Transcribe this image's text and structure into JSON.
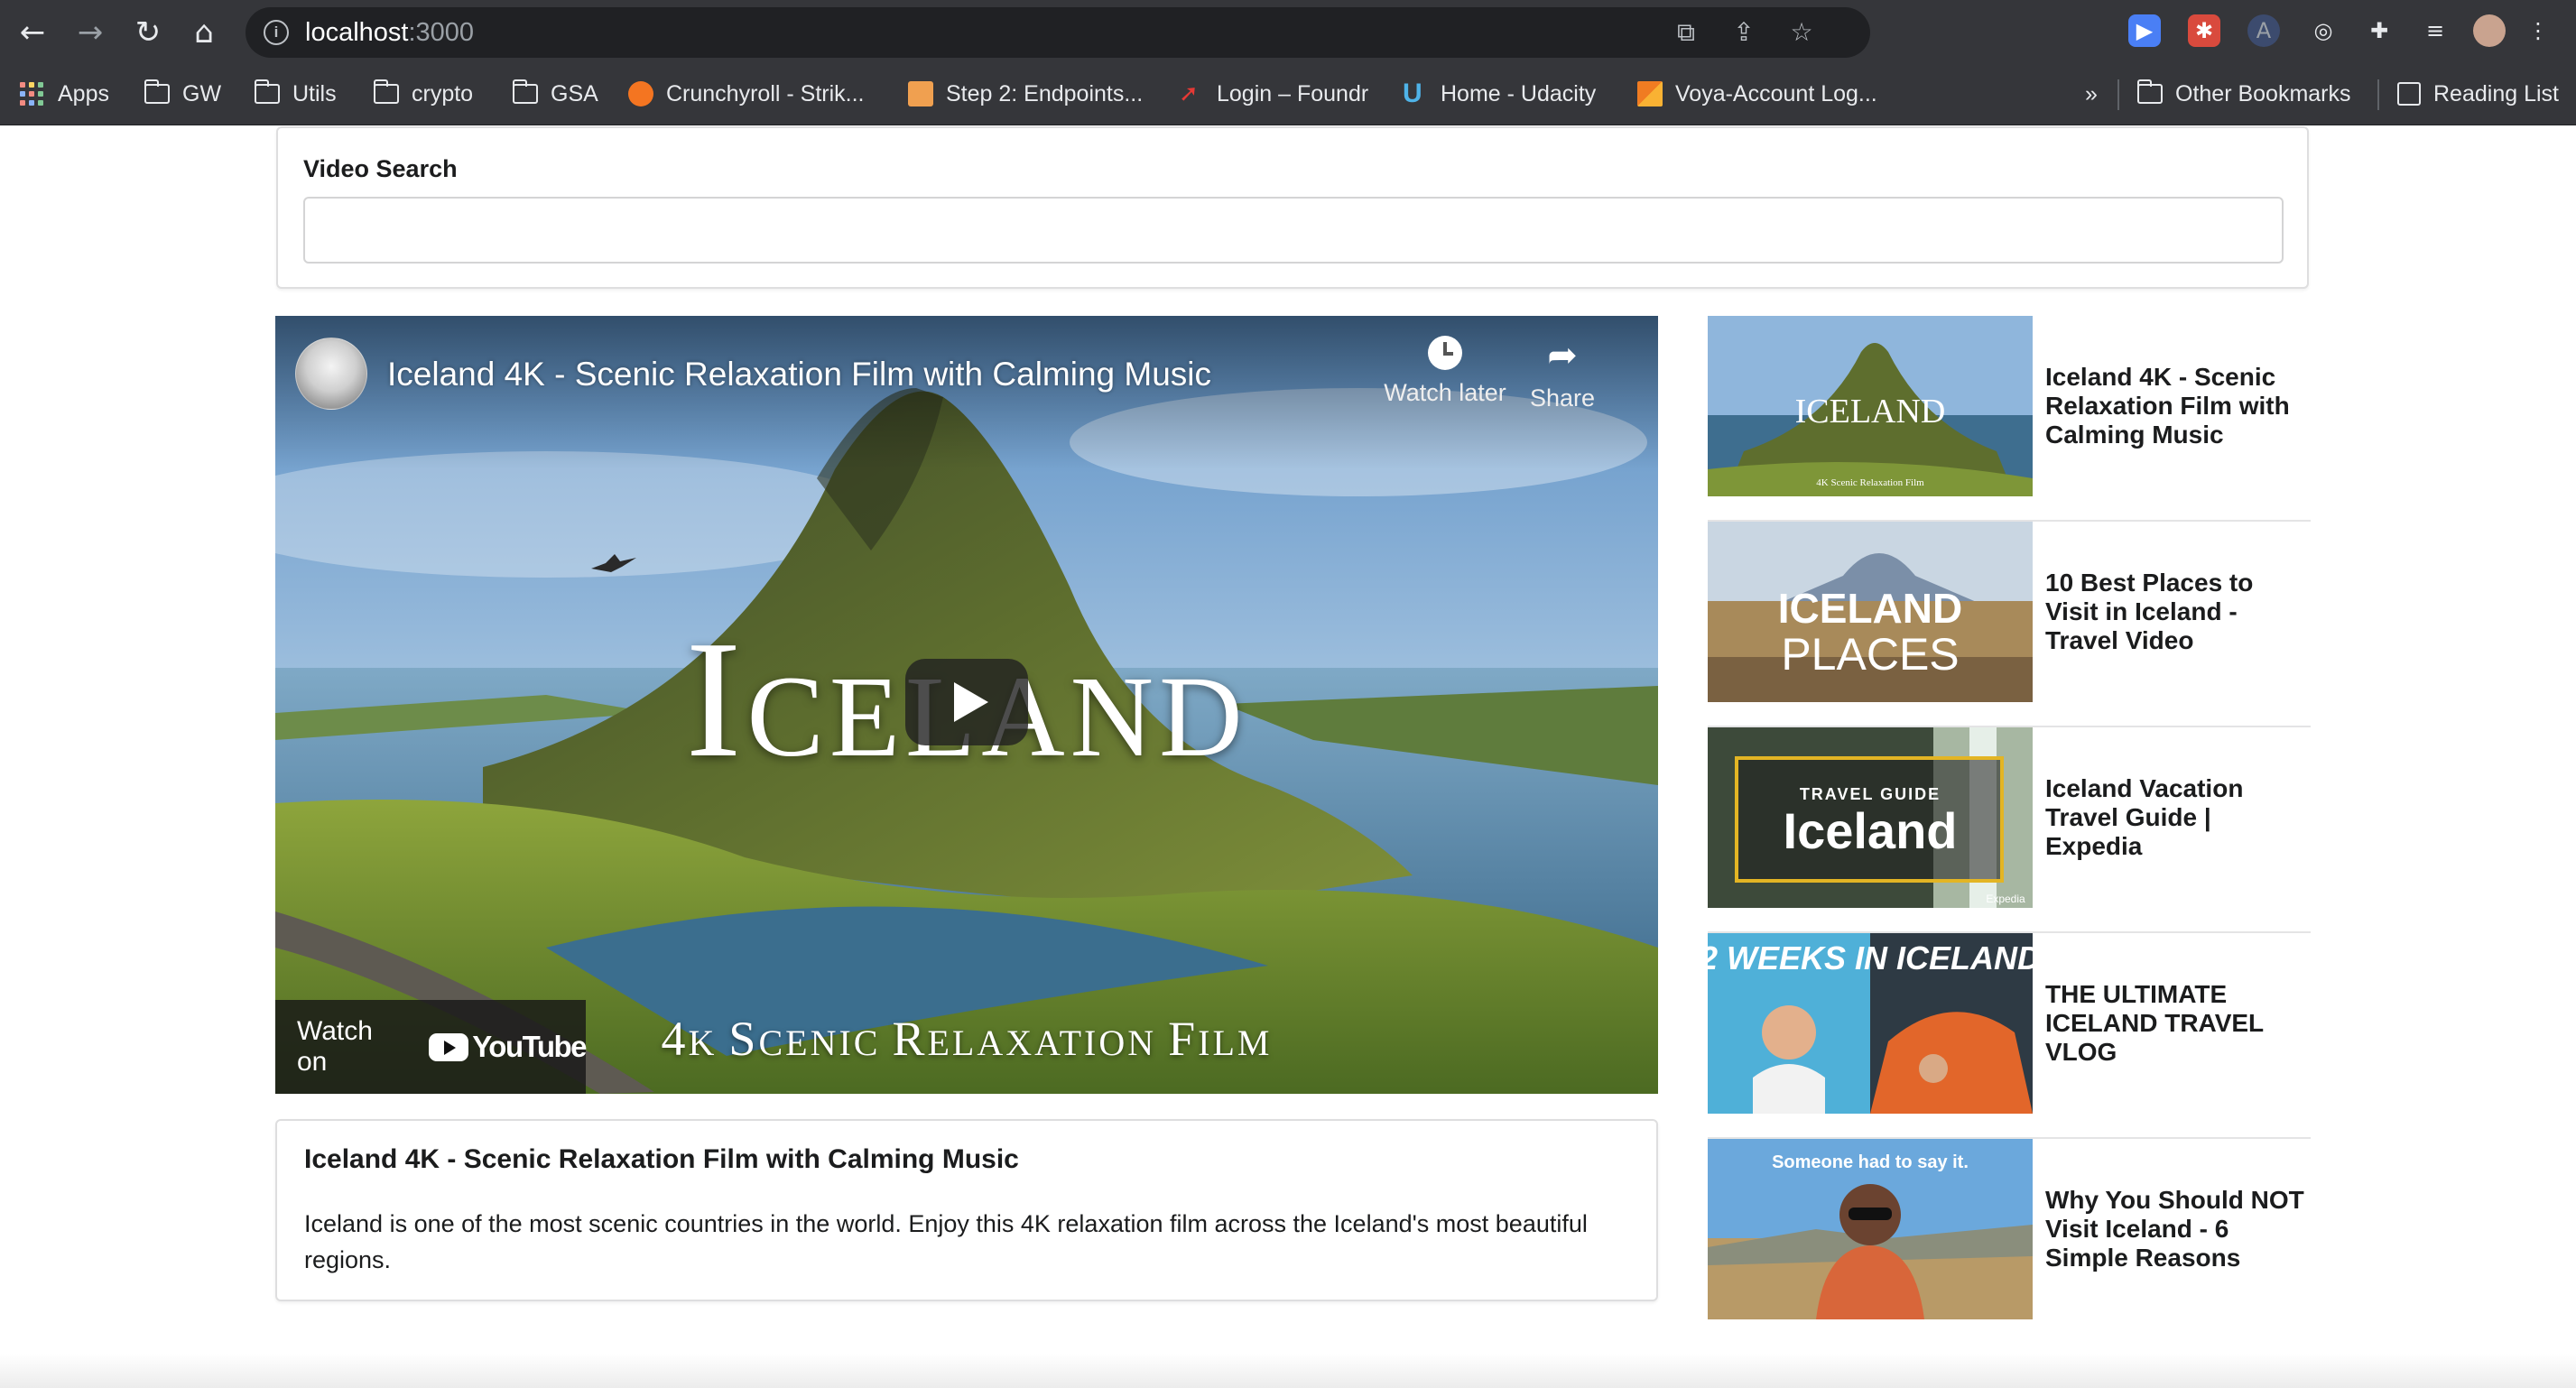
{
  "browser": {
    "url_host": "localhost",
    "url_port": ":3000",
    "bookmarks": [
      {
        "label": "Apps",
        "kind": "apps"
      },
      {
        "label": "GW",
        "kind": "folder"
      },
      {
        "label": "Utils",
        "kind": "folder"
      },
      {
        "label": "crypto",
        "kind": "folder"
      },
      {
        "label": "GSA",
        "kind": "folder"
      },
      {
        "label": "Crunchyroll - Strik...",
        "kind": "crunchyroll"
      },
      {
        "label": "Step 2: Endpoints...",
        "kind": "orange-square"
      },
      {
        "label": "Login – Foundr",
        "kind": "rocket"
      },
      {
        "label": "Home - Udacity",
        "kind": "udacity"
      },
      {
        "label": "Voya-Account Log...",
        "kind": "voya"
      }
    ],
    "overflow_label": "»",
    "other_bookmarks": "Other Bookmarks",
    "reading_list": "Reading List"
  },
  "search": {
    "label": "Video Search",
    "value": "",
    "placeholder": ""
  },
  "player": {
    "title": "Iceland 4K - Scenic Relaxation Film with Calming Music",
    "watch_later": "Watch later",
    "share": "Share",
    "overlay_cap": "I",
    "overlay_rest": "CELAND",
    "subtitle_parts": [
      "4",
      "K ",
      "S",
      "CENIC ",
      "R",
      "ELAXATION ",
      "F",
      "ILM"
    ],
    "watch_on": "Watch on",
    "youtube": "YouTube"
  },
  "details": {
    "title": "Iceland 4K - Scenic Relaxation Film with Calming Music",
    "description": "Iceland is one of the most scenic countries in the world. Enjoy this 4K relaxation film across the Iceland's most beautiful regions."
  },
  "video_list": [
    {
      "title": "Iceland 4K - Scenic Relaxation Film with Calming Music",
      "thumb_text": "ICELAND",
      "thumb_sub": "4K Scenic Relaxation Film"
    },
    {
      "title": "10 Best Places to Visit in Iceland - Travel Video",
      "thumb_text": "ICELAND",
      "thumb_sub": "PLACES"
    },
    {
      "title": "Iceland Vacation Travel Guide | Expedia",
      "thumb_text": "Iceland",
      "thumb_sub": "TRAVEL GUIDE",
      "thumb_brand": "Expedia"
    },
    {
      "title": "THE ULTIMATE ICELAND TRAVEL VLOG",
      "thumb_text": "2 WEEKS IN ICELAND",
      "thumb_sub": ""
    },
    {
      "title": "Why You Should NOT Visit Iceland - 6 Simple Reasons",
      "thumb_text": "Someone had to say it.",
      "thumb_sub": ""
    }
  ]
}
